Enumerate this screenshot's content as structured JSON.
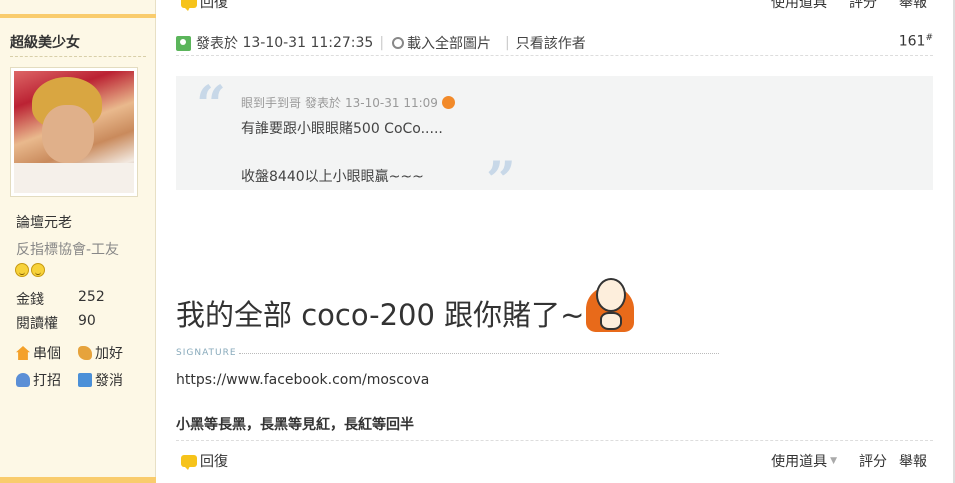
{
  "top_bar": {
    "reply_label": "回復",
    "use_tool_label": "使用道具",
    "rate_label": "評分",
    "report_label": "舉報"
  },
  "author": {
    "username": "超級美少女",
    "rank": "論壇元老",
    "group": "反指標協會-工友",
    "money_label": "金錢",
    "money_value": "252",
    "read_label": "閱讀權",
    "read_value": "90",
    "actions": {
      "home": "串個",
      "add_friend": "加好",
      "greet": "打招",
      "message": "發消"
    }
  },
  "post": {
    "posted_prefix": "發表於",
    "timestamp": "13-10-31 11:27:35",
    "load_images": "載入全部圖片",
    "only_author": "只看該作者",
    "floor": "161",
    "floor_sup": "#",
    "quote": {
      "author": "眼到手到哥",
      "posted_prefix": "發表於",
      "timestamp": "13-10-31 11:09",
      "line1": "有誰要跟小眼眼賭500  CoCo.....",
      "line2": "收盤8440以上小眼眼贏~~~"
    },
    "message": "我的全部 coco-200 跟你賭了~",
    "signature_label": "SIGNATURE",
    "signature_url": "https://www.facebook.com/moscova",
    "signature_motto": "小黑等長黑，長黑等見紅，長紅等回半"
  },
  "footer": {
    "reply_label": "回復",
    "use_tool_label": "使用道具",
    "rate_label": "評分",
    "report_label": "舉報"
  }
}
